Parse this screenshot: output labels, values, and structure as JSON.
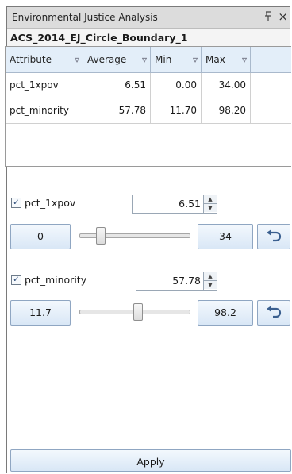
{
  "window": {
    "title": "Environmental Justice Analysis",
    "pin_glyph": "1⃞",
    "close_glyph": "×"
  },
  "layer": {
    "name": "ACS_2014_EJ_Circle_Boundary_1"
  },
  "table": {
    "headers": [
      "Attribute",
      "Average",
      "Min",
      "Max"
    ],
    "rows": [
      {
        "attribute": "pct_1xpov",
        "average": "6.51",
        "min": "0.00",
        "max": "34.00"
      },
      {
        "attribute": "pct_minority",
        "average": "57.78",
        "min": "11.70",
        "max": "98.20"
      }
    ]
  },
  "filters": [
    {
      "label": "pct_1xpov",
      "checked": true,
      "value": "6.51",
      "min_label": "0",
      "max_label": "34",
      "slider_level": 0.19
    },
    {
      "label": "pct_minority",
      "checked": true,
      "value": "57.78",
      "min_label": "11.7",
      "max_label": "98.2",
      "slider_level": 0.53
    }
  ],
  "apply_label": "Apply",
  "icons": {
    "filter": "filter-icon",
    "reset": "undo-icon",
    "pin": "pin-icon",
    "close": "close-icon"
  }
}
